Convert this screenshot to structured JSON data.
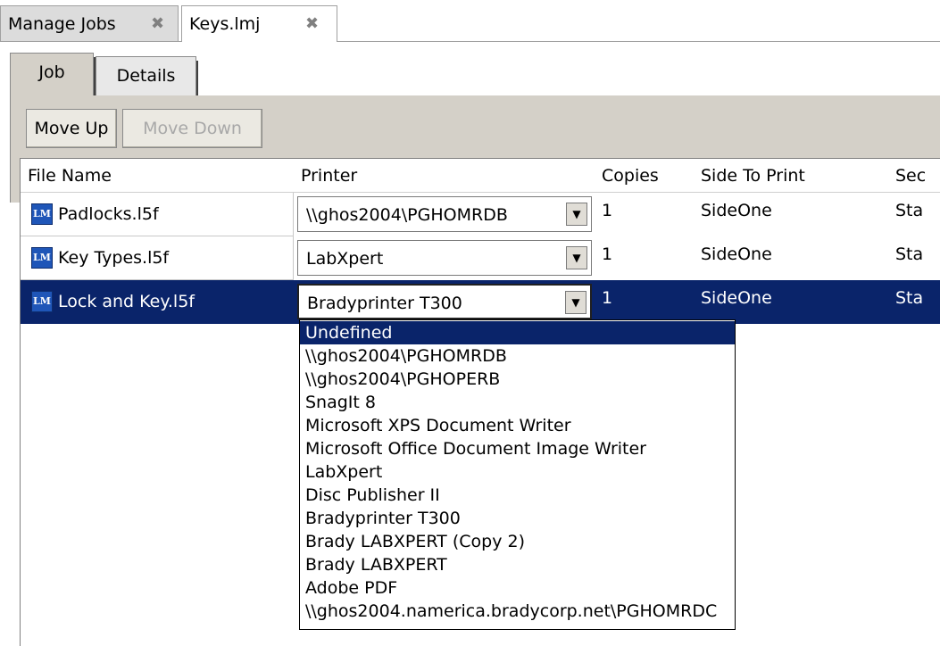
{
  "doc_tabs": [
    {
      "label": "Manage Jobs",
      "close": "✖"
    },
    {
      "label": "Keys.lmj",
      "close": "✖"
    }
  ],
  "panel_tabs": [
    {
      "label": "Job"
    },
    {
      "label": "Details"
    }
  ],
  "toolbar": {
    "move_up_label": "Move Up",
    "move_down_label": "Move Down"
  },
  "grid": {
    "columns": [
      "File Name",
      "Printer",
      "Copies",
      "Side To Print",
      "Sec"
    ],
    "rows": [
      {
        "file": "Padlocks.l5f",
        "printer": "\\\\ghos2004\\PGHOMRDB",
        "copies": "1",
        "side": "SideOne",
        "sec": "Sta"
      },
      {
        "file": "Key Types.l5f",
        "printer": "LabXpert",
        "copies": "1",
        "side": "SideOne",
        "sec": "Sta"
      },
      {
        "file": "Lock and Key.l5f",
        "printer": "Bradyprinter T300",
        "copies": "1",
        "side": "SideOne",
        "sec": "Sta"
      }
    ],
    "selected_row": 2
  },
  "icons": {
    "file_icon": "lm-file-icon",
    "file_icon_text": "LM",
    "dropdown_arrow": "▼"
  },
  "dropdown": {
    "options": [
      "Undefined",
      "\\\\ghos2004\\PGHOMRDB",
      "\\\\ghos2004\\PGHOPERB",
      "SnagIt 8",
      "Microsoft XPS Document Writer",
      "Microsoft Office Document Image Writer",
      "LabXpert",
      "Disc Publisher II",
      "Bradyprinter T300",
      "Brady LABXPERT (Copy 2)",
      "Brady LABXPERT",
      "Adobe PDF",
      "\\\\ghos2004.namerica.bradycorp.net\\PGHOMRDC"
    ],
    "highlighted": "Undefined"
  },
  "colors": {
    "selection": "#0a246a",
    "toolbar_bg": "#d4d0c8"
  }
}
